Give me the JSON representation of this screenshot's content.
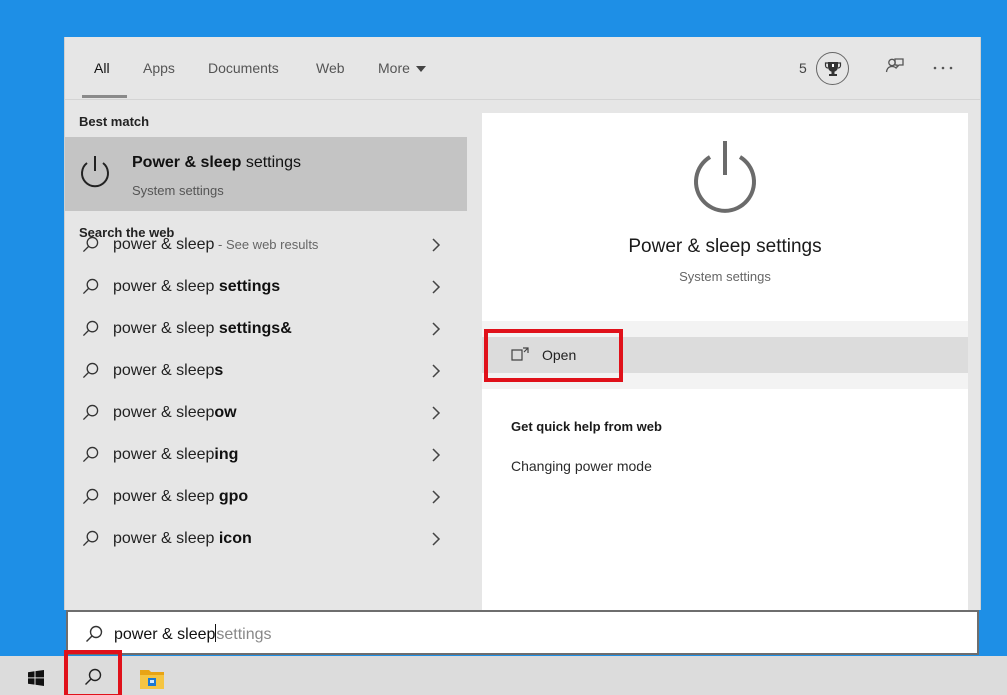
{
  "tabs": [
    {
      "label": "All"
    },
    {
      "label": "Apps"
    },
    {
      "label": "Documents"
    },
    {
      "label": "Web"
    },
    {
      "label": "More"
    }
  ],
  "reward_count": "5",
  "best_match": {
    "section_label": "Best match",
    "title_bold": "Power & sleep",
    "title_rest": " settings",
    "subtitle": "System settings"
  },
  "search_web": {
    "section_label": "Search the web",
    "items": [
      {
        "prefix": "power & sleep",
        "bold": "",
        "suffix": " - See web results"
      },
      {
        "prefix": "power & sleep ",
        "bold": "settings",
        "suffix": ""
      },
      {
        "prefix": "power & sleep ",
        "bold": "settings&",
        "suffix": ""
      },
      {
        "prefix": "power & sleep",
        "bold": "s",
        "suffix": ""
      },
      {
        "prefix": "power & sleep",
        "bold": "ow",
        "suffix": ""
      },
      {
        "prefix": "power & sleep",
        "bold": "ing",
        "suffix": ""
      },
      {
        "prefix": "power & sleep ",
        "bold": "gpo",
        "suffix": ""
      },
      {
        "prefix": "power & sleep ",
        "bold": "icon",
        "suffix": ""
      }
    ]
  },
  "preview": {
    "title": "Power & sleep settings",
    "subtitle": "System settings",
    "open_label": "Open",
    "help_title": "Get quick help from web",
    "help_link": "Changing power mode"
  },
  "search_box": {
    "typed": "power & sleep",
    "suggestion": "settings"
  }
}
